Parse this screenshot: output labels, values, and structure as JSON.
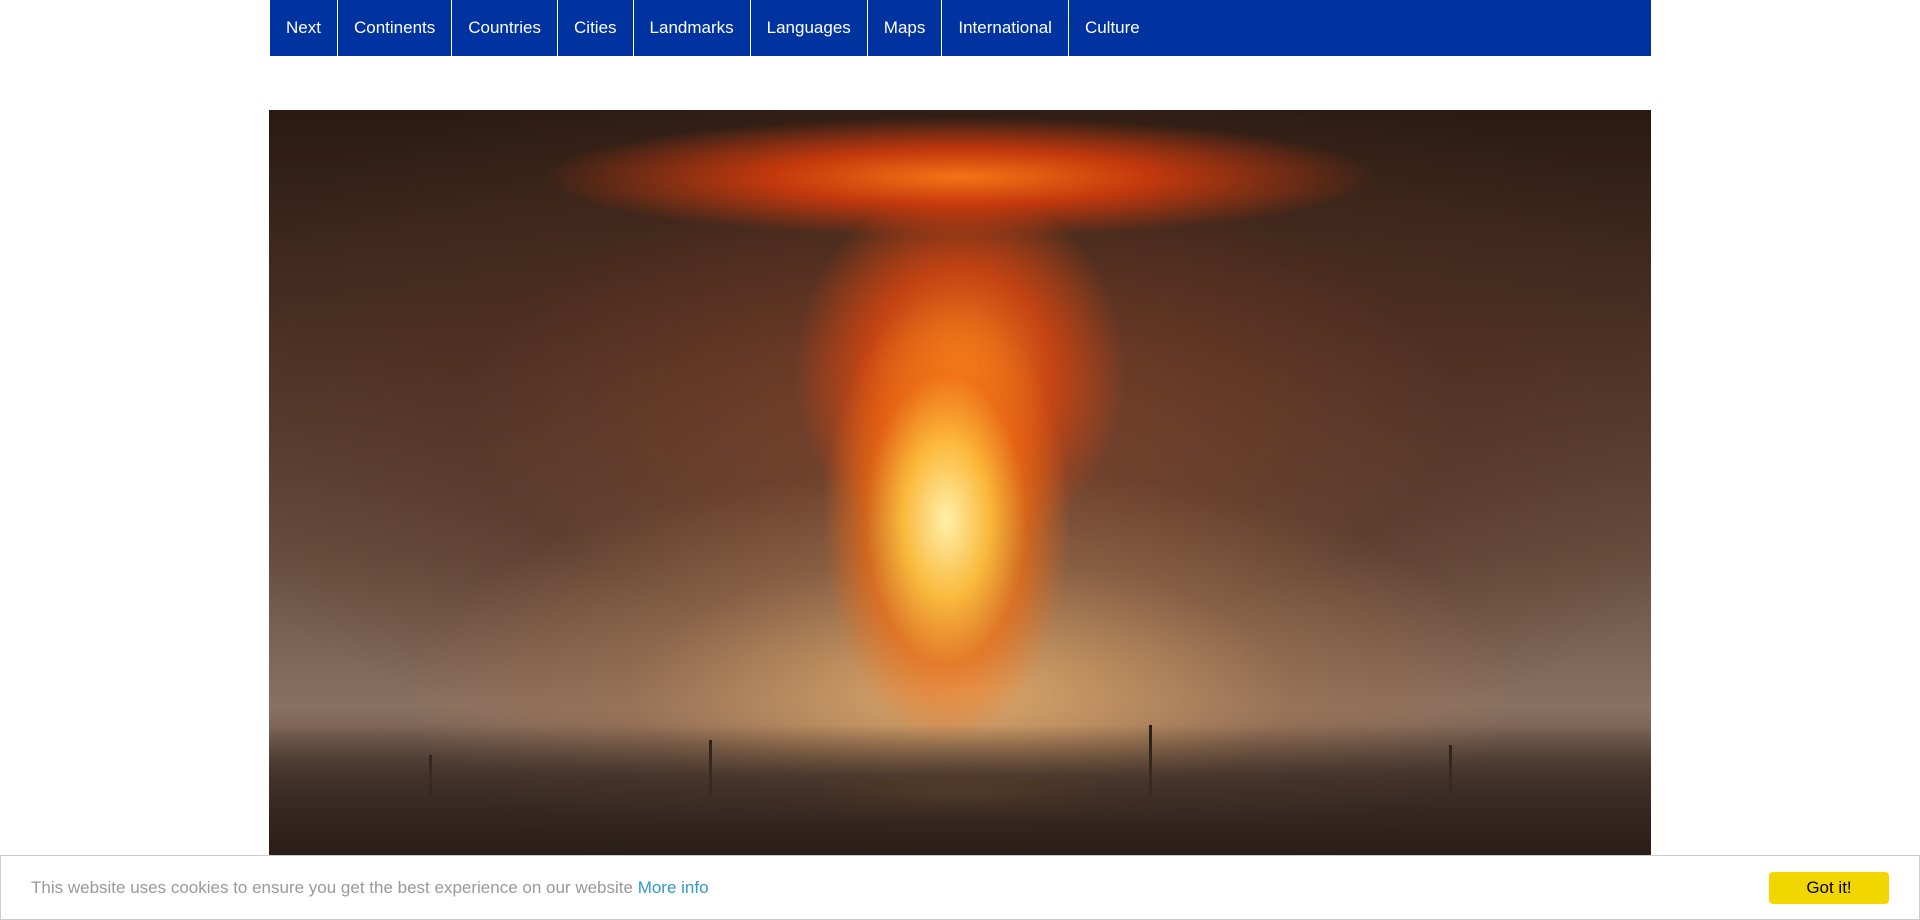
{
  "nav": {
    "items": [
      {
        "label": "Next"
      },
      {
        "label": "Continents"
      },
      {
        "label": "Countries"
      },
      {
        "label": "Cities"
      },
      {
        "label": "Landmarks"
      },
      {
        "label": "Languages"
      },
      {
        "label": "Maps"
      },
      {
        "label": "International"
      },
      {
        "label": "Culture"
      }
    ]
  },
  "hero": {
    "subject": "explosion-image"
  },
  "cookie": {
    "message": "This website uses cookies to ensure you get the best experience on our website",
    "link_label": "More info",
    "button_label": "Got it!"
  },
  "colors": {
    "nav_bg": "#0033a0",
    "cookie_button": "#f1d600",
    "cookie_link": "#3399cc"
  }
}
